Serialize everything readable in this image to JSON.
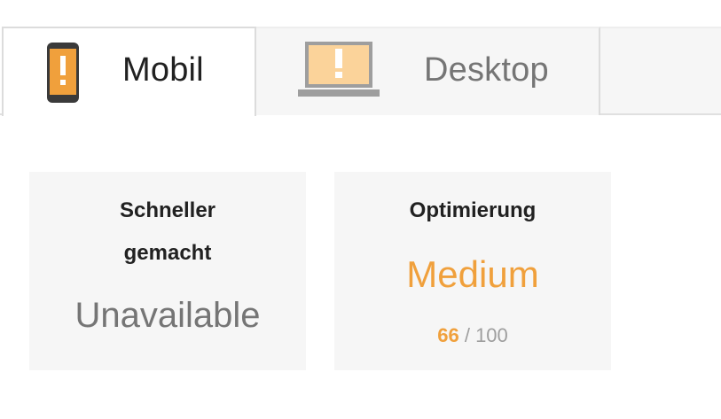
{
  "tabs": {
    "mobile": {
      "label": "Mobil",
      "icon": "mobile-phone-warning-icon",
      "selected": true
    },
    "desktop": {
      "label": "Desktop",
      "icon": "laptop-warning-icon",
      "selected": false
    }
  },
  "cards": {
    "speed": {
      "title_line1": "Schneller",
      "title_line2": "gemacht",
      "value": "Unavailable"
    },
    "optimization": {
      "title": "Optimierung",
      "rating": "Medium",
      "score": "66",
      "separator": "/",
      "max_score": "100"
    }
  },
  "colors": {
    "accent": "#f0a03c",
    "card_background": "#f6f6f6",
    "text_dark": "#212121",
    "text_gray": "#757575"
  }
}
